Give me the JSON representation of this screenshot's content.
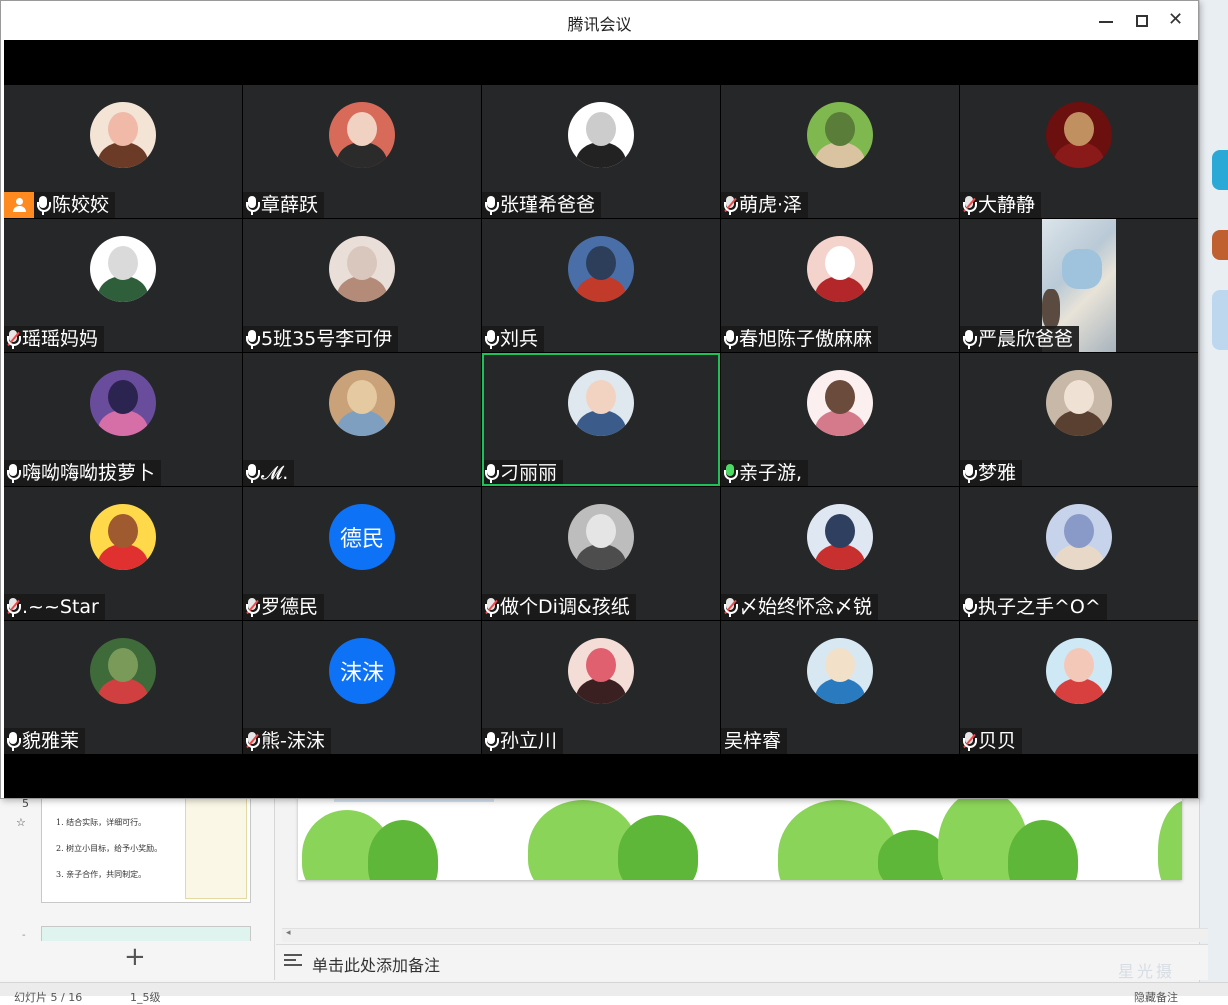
{
  "window": {
    "title": "腾讯会议",
    "minimize_icon": "minimize-icon",
    "maximize_icon": "maximize-icon",
    "close_icon": "close-icon",
    "close_glyph": "✕"
  },
  "colors": {
    "host_badge": "#ff8a1f",
    "active_speaker_border": "#1fbf5a",
    "muted_slash": "#f04848",
    "tile_background": "#262729",
    "text_avatar": "#0d72f5"
  },
  "participants": [
    {
      "name": "陈姣姣",
      "mic": "on",
      "host": true,
      "avatar": "photo"
    },
    {
      "name": "章薛跃",
      "mic": "on",
      "avatar": "photo"
    },
    {
      "name": "张瑾希爸爸",
      "mic": "on",
      "avatar": "photo"
    },
    {
      "name": "萌虎·泽",
      "mic": "muted",
      "avatar": "photo"
    },
    {
      "name": "大静静",
      "mic": "muted",
      "avatar": "photo"
    },
    {
      "name": "瑶瑶妈妈",
      "mic": "muted",
      "avatar": "photo"
    },
    {
      "name": "5班35号李可伊",
      "mic": "on",
      "avatar": "photo"
    },
    {
      "name": "刘兵",
      "mic": "on",
      "avatar": "photo"
    },
    {
      "name": "春旭陈子傲麻麻",
      "mic": "on",
      "avatar": "photo"
    },
    {
      "name": "严晨欣爸爸",
      "mic": "on",
      "avatar": "video"
    },
    {
      "name": "嗨呦嗨呦拔萝卜",
      "mic": "on",
      "avatar": "photo"
    },
    {
      "name": "𝓜.",
      "mic": "on",
      "avatar": "photo"
    },
    {
      "name": "刁丽丽",
      "mic": "on",
      "active": true,
      "avatar": "photo"
    },
    {
      "name": "亲子游,",
      "mic": "speaking",
      "avatar": "photo"
    },
    {
      "name": "梦雅",
      "mic": "on",
      "avatar": "photo"
    },
    {
      "name": ".~~Star",
      "mic": "muted",
      "avatar": "photo"
    },
    {
      "name": "罗德民",
      "mic": "muted",
      "avatar": "text",
      "avatar_text": "德民"
    },
    {
      "name": "做个Di调&孩纸",
      "mic": "muted",
      "avatar": "photo"
    },
    {
      "name": "〆始终怀念〆锐",
      "mic": "muted",
      "avatar": "photo"
    },
    {
      "name": "执子之手^O^",
      "mic": "on",
      "avatar": "photo"
    },
    {
      "name": "貌雅茉",
      "mic": "on",
      "avatar": "photo"
    },
    {
      "name": "熊-沫沫",
      "mic": "muted",
      "avatar": "text",
      "avatar_text": "沫沫"
    },
    {
      "name": "孙立川",
      "mic": "on",
      "avatar": "photo"
    },
    {
      "name": "吴梓睿",
      "mic": "none",
      "avatar": "photo"
    },
    {
      "name": "贝贝",
      "mic": "muted",
      "avatar": "photo"
    }
  ],
  "background_app": {
    "slide_number": "5",
    "slide_star": "☆",
    "thumb_lines": [
      "1. 结合实际，详细可行。",
      "2. 树立小目标，给予小奖励。",
      "3. 亲子合作，共同制定。"
    ],
    "add_slide": "+",
    "notes_placeholder": "单击此处添加备注",
    "watermark": "星光摄",
    "status_left": "幻灯片 5 / 16",
    "status_mid": "1_5级",
    "status_right": "隐藏备注"
  }
}
